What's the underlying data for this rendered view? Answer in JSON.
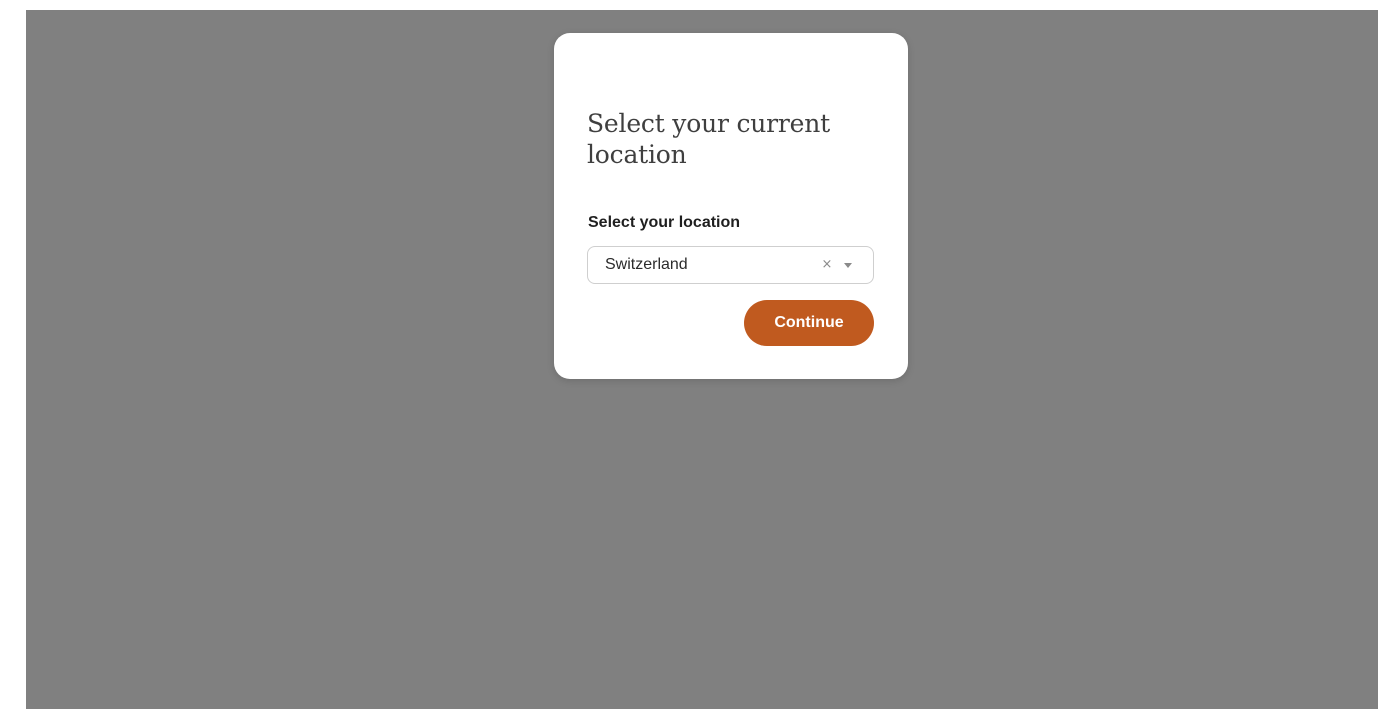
{
  "modal": {
    "title": "Select your current location",
    "field_label": "Select your location",
    "selected_location": "Switzerland",
    "clear_symbol": "×",
    "continue_label": "Continue"
  },
  "icons": {
    "clear": "close-icon",
    "dropdown": "chevron-down-icon"
  },
  "colors": {
    "overlay": "#808080",
    "modal_background": "#ffffff",
    "accent_button": "#c05a1f",
    "title_text": "#3f3f3f"
  }
}
